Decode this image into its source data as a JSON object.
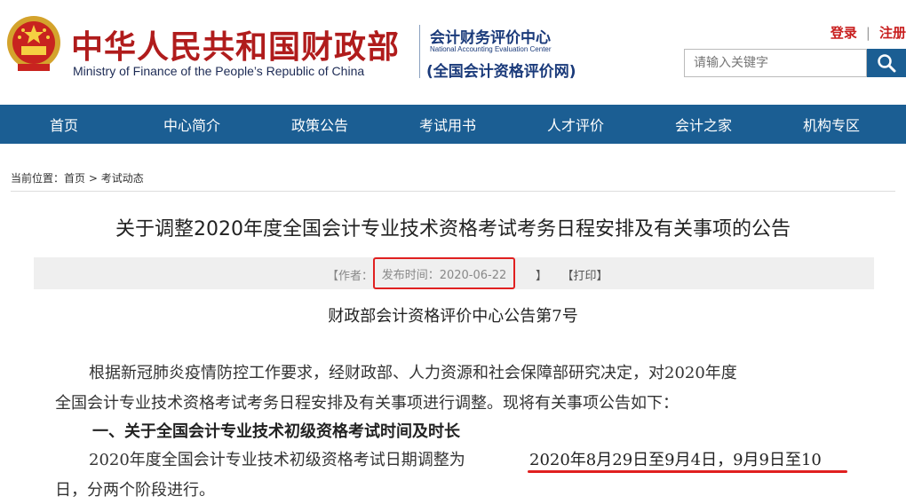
{
  "header": {
    "ministry_cn": "中华人民共和国财政部",
    "ministry_en": "Ministry of Finance of the People’s Republic of China",
    "center_cn": "会计财务评价中心",
    "center_en": "National Accounting Evaluation Center",
    "center_net": "(全国会计资格评价网)",
    "login": "登录",
    "separator": "|",
    "register": "注册",
    "search_placeholder": "请输入关键字"
  },
  "nav": {
    "items": [
      "首页",
      "中心简介",
      "政策公告",
      "考试用书",
      "人才评价",
      "会计之家",
      "机构专区"
    ]
  },
  "breadcrumb": {
    "prefix": "当前位置：",
    "home": "首页",
    "sep": " > ",
    "current": "考试动态"
  },
  "article": {
    "title": "关于调整2020年度全国会计专业技术资格考试考务日程安排及有关事项的公告",
    "author_label": "【作者：",
    "date_label": "发布时间：2020-06-22",
    "close_bracket": "】",
    "print_label": "【打印】",
    "notice_no": "财政部会计资格评价中心公告第7号",
    "para1_line1": "根据新冠肺炎疫情防控工作要求，经财政部、人力资源和社会保障部研究决定，对2020年度",
    "para1_line2": "全国会计专业技术资格考试考务日程安排及有关事项进行调整。现将有关事项公告如下：",
    "section1_heading": "一、关于全国会计专业技术初级资格考试时间及时长",
    "para2_prefix": "2020年度全国会计专业技术初级资格考试日期调整为",
    "para2_highlight": "2020年8月29日至9月4日，9月9日至10",
    "para2_line2": "日，分两个阶段进行。"
  },
  "colors": {
    "brand_red": "#b01c1c",
    "nav_blue": "#1b5e93",
    "highlight_red": "#e02020"
  }
}
